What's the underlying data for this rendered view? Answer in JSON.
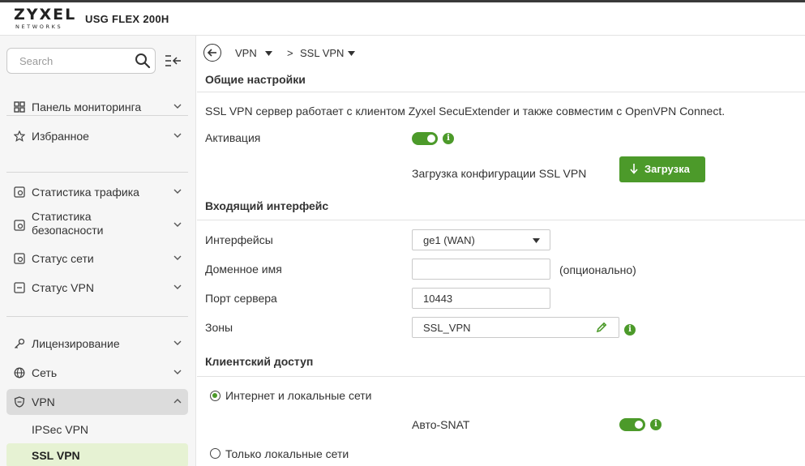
{
  "header": {
    "logo_main": "ZYXEL",
    "logo_sub": "NETWORKS",
    "model": "USG FLEX 200H"
  },
  "sidebar": {
    "search_placeholder": "Search",
    "groups": [
      {
        "items": [
          {
            "label": "Панель мониторинга",
            "icon": "dashboard-icon"
          },
          {
            "label": "Избранное",
            "icon": "star-icon"
          }
        ]
      },
      {
        "items": [
          {
            "label": "Статистика трафика",
            "icon": "traffic-stats-icon"
          },
          {
            "label": "Статистика безопасности",
            "icon": "security-stats-icon"
          },
          {
            "label": "Статус сети",
            "icon": "network-status-icon"
          },
          {
            "label": "Статус VPN",
            "icon": "vpn-status-icon"
          }
        ]
      },
      {
        "items": [
          {
            "label": "Лицензирование",
            "icon": "key-icon"
          },
          {
            "label": "Сеть",
            "icon": "globe-icon"
          },
          {
            "label": "VPN",
            "icon": "shield-icon",
            "expanded": true
          }
        ]
      }
    ],
    "vpn_subitems": [
      {
        "label": "IPSec VPN"
      },
      {
        "label": "SSL VPN",
        "selected": true
      }
    ]
  },
  "breadcrumb": {
    "first": "VPN",
    "separator": ">",
    "second": "SSL VPN"
  },
  "general": {
    "title": "Общие настройки",
    "description": "SSL VPN сервер работает с клиентом Zyxel SecuExtender и также совместим с OpenVPN Connect.",
    "activation_label": "Активация",
    "activation_on": true,
    "download_label": "Загрузка конфигурации SSL VPN",
    "download_button": "Загрузка"
  },
  "incoming": {
    "title": "Входящий интерфейс",
    "interfaces_label": "Интерфейсы",
    "interfaces_value": "ge1 (WAN)",
    "domain_label": "Доменное имя",
    "domain_value": "",
    "domain_hint": "(опционально)",
    "port_label": "Порт сервера",
    "port_value": "10443",
    "zones_label": "Зоны",
    "zones_value": "SSL_VPN"
  },
  "client_access": {
    "title": "Клиентский доступ",
    "option1": "Интернет и локальные сети",
    "option1_selected": true,
    "auto_snat_label": "Авто-SNAT",
    "auto_snat_on": true,
    "option2": "Только локальные сети"
  },
  "colors": {
    "accent": "#4c9a2a",
    "selected_bg": "#e6f2d3"
  }
}
